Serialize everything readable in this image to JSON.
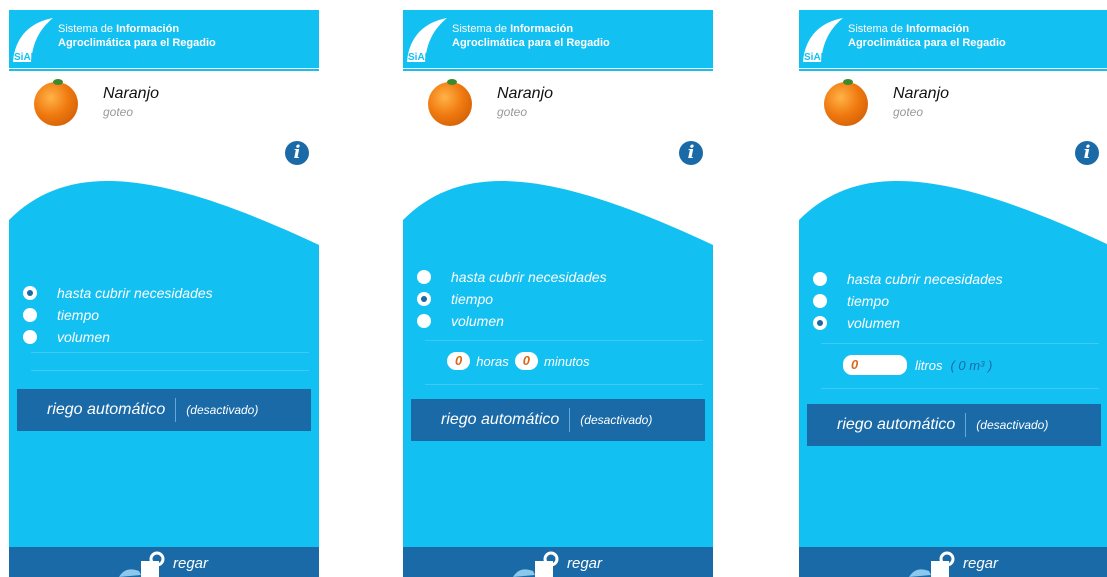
{
  "header": {
    "title_prefix": "Sistema de ",
    "title_bold": "Información",
    "title_line2": "Agroclimática para el Regadio",
    "logo_text": "SiAR"
  },
  "crop": {
    "name": "Naranjo",
    "type": "goteo"
  },
  "info_label": "i",
  "options": [
    "hasta cubrir necesidades",
    "tiempo",
    "volumen"
  ],
  "auto": {
    "label": "riego automático",
    "state": "(desactivado)"
  },
  "bottom": {
    "label": "regar"
  },
  "screens": [
    {
      "selected": "hasta cubrir necesidades"
    },
    {
      "selected": "tiempo",
      "horas_value": "0",
      "horas_label": "horas",
      "minutos_value": "0",
      "minutos_label": "minutos"
    },
    {
      "selected": "volumen",
      "litros_value": "0",
      "litros_label": "litros",
      "m3_label": "( 0 m³ )"
    }
  ],
  "colors": {
    "sky": "#13c0f2",
    "dark": "#1a6aa8",
    "radio_dot": "#1a6aa5"
  }
}
